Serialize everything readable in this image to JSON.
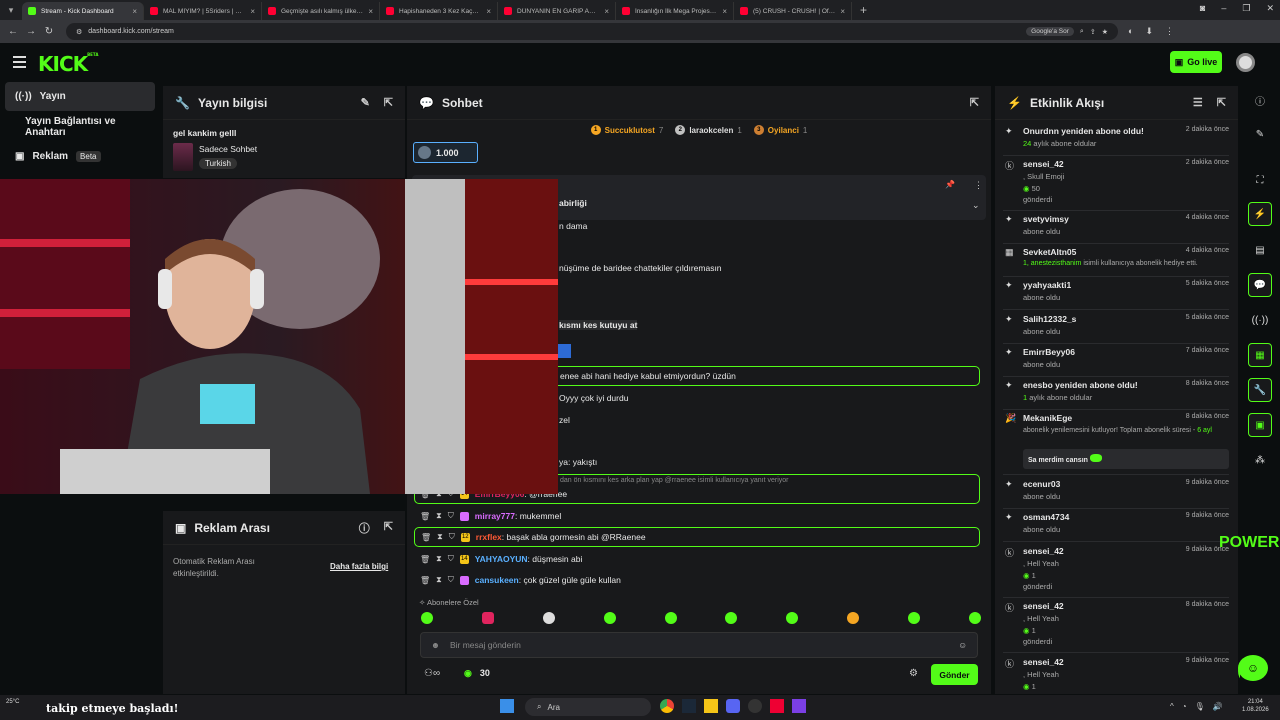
{
  "browser": {
    "tabs": [
      {
        "title": "Stream - Kick Dashboard",
        "color": "#53fc18",
        "active": true
      },
      {
        "title": "MAL MIYIM? | 5Sriders | Motor",
        "color": "#ff0033"
      },
      {
        "title": "Geçmişte asılı kalmış ülke: Küba",
        "color": "#ff0033"
      },
      {
        "title": "Hapishaneden 3 Kez Kaçan Adam",
        "color": "#ff0033"
      },
      {
        "title": "DÜNYANIN EN GARİP ADASINI",
        "color": "#ff0033"
      },
      {
        "title": "İnsanlığın İlk Mega Projesi Göb",
        "color": "#ff0033"
      },
      {
        "title": "(5) CRUSH - CRUSH! | Official M",
        "color": "#ff0033"
      }
    ],
    "url": "dashboard.kick.com/stream",
    "google_search": "Google'a Sor"
  },
  "header": {
    "logo": "KICK",
    "logo_sup": "BETA",
    "go_live": "Go live"
  },
  "leftnav": {
    "items": [
      {
        "label": "Yayın",
        "icon": "broadcast-icon"
      },
      {
        "label": "Yayın Bağlantısı ve Anahtarı"
      },
      {
        "label": "Reklam",
        "badge": "Beta",
        "icon": "ad-icon"
      }
    ]
  },
  "stream_info": {
    "title": "Yayın bilgisi",
    "stream_title": "gel kankim gelll",
    "category": "Sadece Sohbet",
    "language_tag": "Turkish"
  },
  "ad_break": {
    "title": "Reklam Arası",
    "text": "Otomatik Reklam Arası etkinleştirildi.",
    "link": "Daha fazla bilgi"
  },
  "chat": {
    "title": "Sohbet",
    "top_gifters": [
      {
        "rank": "1",
        "name": "Succuklutost",
        "count": "7",
        "color": "#f5a623"
      },
      {
        "rank": "2",
        "name": "laraokcelen",
        "count": "1",
        "color": "#c0c0c0"
      },
      {
        "rank": "3",
        "name": "Oyilanci",
        "count": "1",
        "color": "#cd7f32"
      }
    ],
    "pinned_count": "1.000",
    "pinned_title_frag": "abirliği",
    "partial_lines": [
      "n dama",
      "nüşüme de baridee chattekiler çıldıremasın",
      "kısmı kes kutuyu at",
      "enee abi hani hediye kabul etmiyordun? üzdün",
      "Oyyy çok iyi durdu",
      "zel",
      "ya: yakıştı"
    ],
    "reply_hint": "dan ön kısmını kes arka plan yap @rraenee isimli kullanıcıya yanıt veriyor",
    "messages": [
      {
        "user": "EmrrBeyy06",
        "text": "@rraenee",
        "color": "#e0245e",
        "badge": "14"
      },
      {
        "user": "mirray777",
        "text": "mukemmel",
        "color": "#d96bff",
        "badge": ""
      },
      {
        "user": "rrxflex",
        "text": "başak abla gormesin abi @RRaenee",
        "color": "#ff5a36",
        "badge": "12"
      },
      {
        "user": "YAHYAOYUN",
        "text": "düşmesin abi",
        "color": "#5ab0ff",
        "badge": "14"
      },
      {
        "user": "cansukeen",
        "text": "çok güzel güle güle kullan",
        "color": "#5ab0ff",
        "badge": ""
      }
    ],
    "emote_section": "Abonelere Özel",
    "input_placeholder": "Bir mesaj gönderin",
    "points": "30",
    "send": "Gönder"
  },
  "feed": {
    "title": "Etkinlik Akışı",
    "items": [
      {
        "who": "Onurdnn yeniden abone oldu!",
        "when": "2 dakika önce",
        "sub_hl": "24",
        "sub": " aylık abone oldular",
        "icon": "star-icon"
      },
      {
        "who": "sensei_42",
        "when": "2 dakika önce",
        "sub_hl": ", Skull Emoji",
        "sub": "",
        "extra": "50",
        "extra2": "gönderdi",
        "icon": "kick-icon"
      },
      {
        "who": "svetyvimsy",
        "when": "4 dakika önce",
        "sub": "abone oldu",
        "icon": "star-icon"
      },
      {
        "who": "SevketAltn05",
        "when": "4 dakika önce",
        "sub_hl": "1, anestezisthanim",
        "sub": " isimli kullanıcıya abonelik hediye etti.",
        "icon": "gift-icon"
      },
      {
        "who": "yyahyaakti1",
        "when": "5 dakika önce",
        "sub": "abone oldu",
        "icon": "star-icon"
      },
      {
        "who": "Salih12332_s",
        "when": "5 dakika önce",
        "sub": "abone oldu",
        "icon": "star-icon"
      },
      {
        "who": "EmirrBeyy06",
        "when": "7 dakika önce",
        "sub": "abone oldu",
        "icon": "star-icon"
      },
      {
        "who": "enesbo yeniden abone oldu!",
        "when": "8 dakika önce",
        "sub_hl": "1",
        "sub": " aylık abone oldular",
        "icon": "star-icon"
      },
      {
        "who": "MekanikEge",
        "when": "8 dakika önce",
        "sub": "abonelik yenilemesini kutluyor! Toplam abonelik süresi -",
        "sub_hl": "6 ayl",
        "quote": "Sa merdim cansın",
        "icon": "party-icon"
      },
      {
        "who": "ecenur03",
        "when": "9 dakika önce",
        "sub": "abone oldu",
        "icon": "star-icon"
      },
      {
        "who": "osman4734",
        "when": "9 dakika önce",
        "sub": "abone oldu",
        "icon": "star-icon"
      },
      {
        "who": "sensei_42",
        "when": "9 dakika önce",
        "sub_hl": ", Hell Yeah",
        "extra": "1",
        "extra2": "gönderdi",
        "icon": "kick-icon"
      },
      {
        "who": "sensei_42",
        "when": "8 dakika önce",
        "sub_hl": ", Hell Yeah",
        "extra": "1",
        "extra2": "gönderdi",
        "icon": "kick-icon"
      },
      {
        "who": "sensei_42",
        "when": "9 dakika önce",
        "sub_hl": ", Hell Yeah",
        "extra": "1",
        "icon": "kick-icon"
      }
    ]
  },
  "overlay": {
    "power_text": "POWER",
    "ticker": "takip etmeye başladı!"
  },
  "taskbar": {
    "weather": "25°C",
    "search": "Ara",
    "time": "21:04",
    "date": "1.08.2026"
  }
}
